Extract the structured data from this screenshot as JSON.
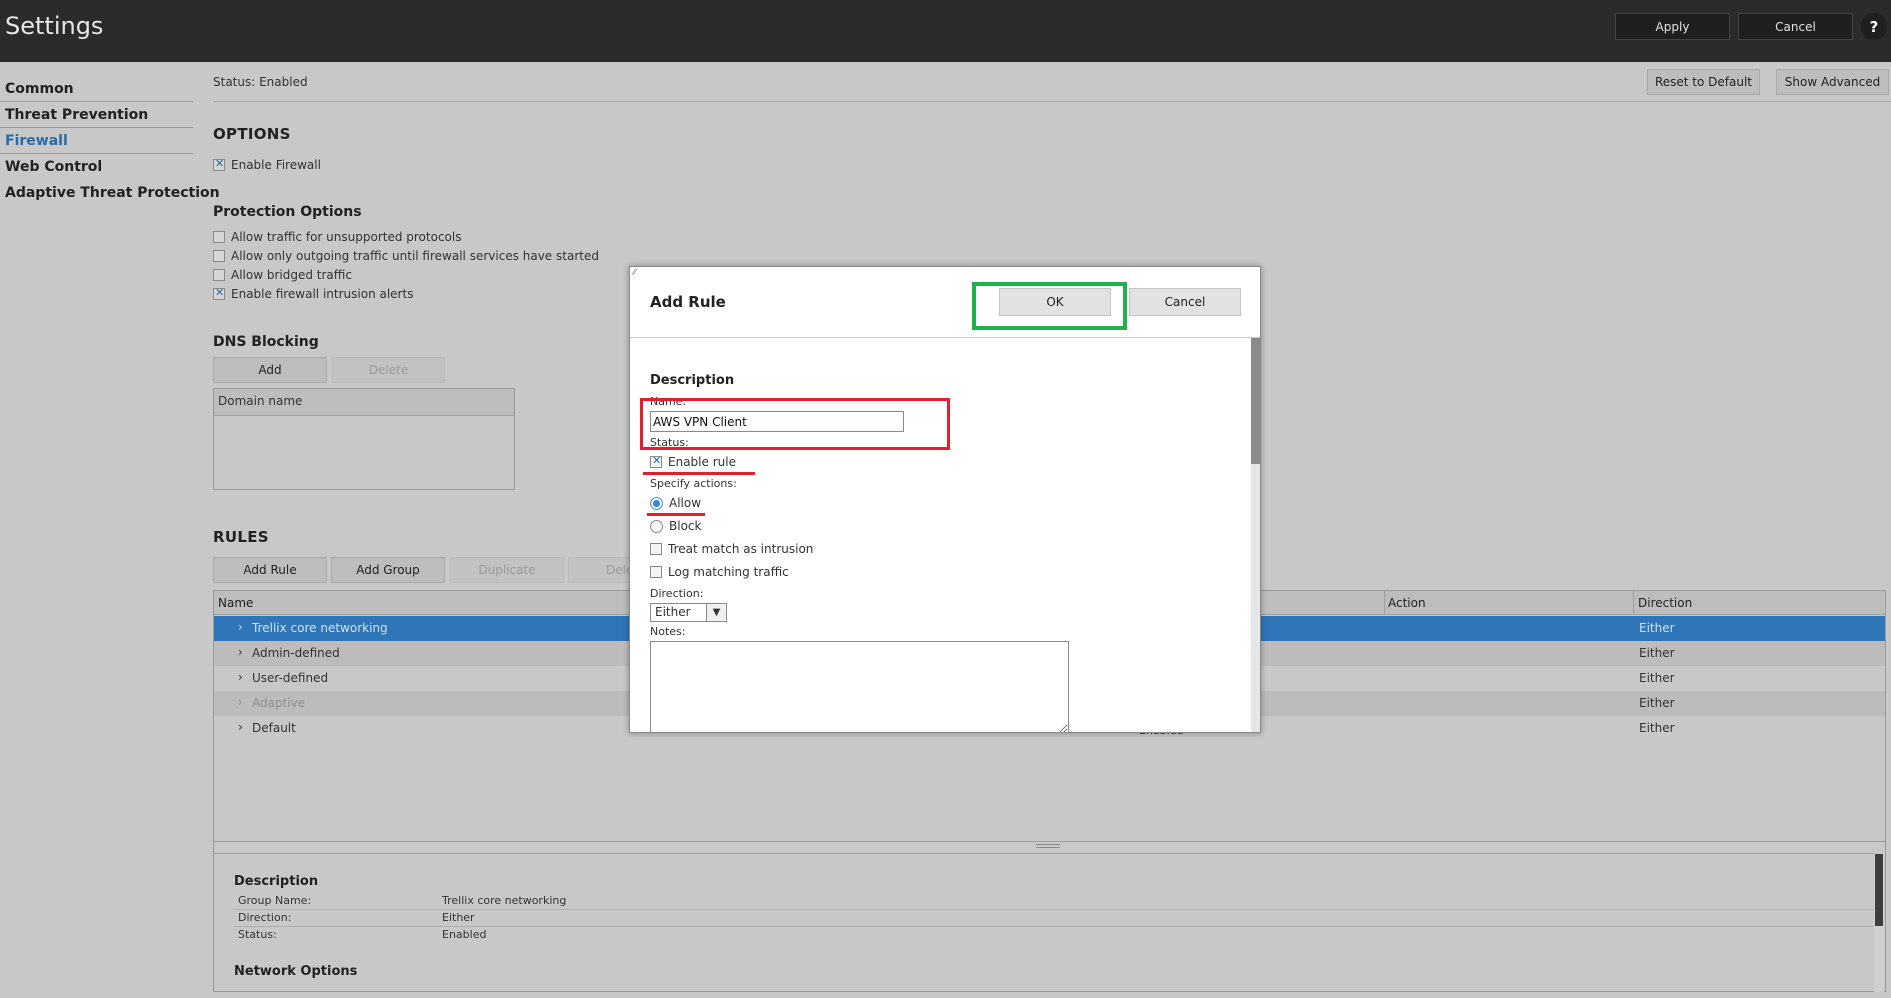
{
  "header": {
    "title": "Settings",
    "apply_label": "Apply",
    "cancel_label": "Cancel",
    "help_label": "?"
  },
  "nav": {
    "items": [
      {
        "label": "Common",
        "active": false
      },
      {
        "label": "Threat Prevention",
        "active": false
      },
      {
        "label": "Firewall",
        "active": true
      },
      {
        "label": "Web Control",
        "active": false
      },
      {
        "label": "Adaptive Threat Protection",
        "active": false
      }
    ]
  },
  "main": {
    "status_text": "Status: Enabled",
    "reset_label": "Reset to Default",
    "show_advanced_label": "Show Advanced",
    "options_title": "OPTIONS",
    "enable_firewall_label": "Enable Firewall",
    "protection_title": "Protection Options",
    "protection_options": [
      {
        "label": "Allow traffic for unsupported protocols",
        "checked": false
      },
      {
        "label": "Allow only outgoing traffic until firewall services have started",
        "checked": false
      },
      {
        "label": "Allow bridged traffic",
        "checked": false
      },
      {
        "label": "Enable firewall intrusion alerts",
        "checked": true
      }
    ],
    "dns_title": "DNS Blocking",
    "dns_add_label": "Add",
    "dns_delete_label": "Delete",
    "dns_column": "Domain name",
    "rules_title": "RULES",
    "rules_buttons": {
      "add_rule": "Add Rule",
      "add_group": "Add Group",
      "duplicate": "Duplicate",
      "delete": "Dele"
    },
    "rules_columns": {
      "name": "Name",
      "action": "Action",
      "direction": "Direction"
    },
    "rules_rows": [
      {
        "name": "Trellix core networking",
        "direction": "Either",
        "status": ""
      },
      {
        "name": "Admin-defined",
        "direction": "Either",
        "status": ""
      },
      {
        "name": "User-defined",
        "direction": "Either",
        "status": ""
      },
      {
        "name": "Adaptive",
        "direction": "Either",
        "status": ""
      },
      {
        "name": "Default",
        "direction": "Either",
        "status": "Enabled"
      }
    ],
    "description": {
      "title": "Description",
      "group_name_label": "Group Name:",
      "group_name_value": "Trellix core networking",
      "direction_label": "Direction:",
      "direction_value": "Either",
      "status_label": "Status:",
      "status_value": "Enabled",
      "network_options_title": "Network Options"
    }
  },
  "modal": {
    "title": "Add Rule",
    "ok_label": "OK",
    "cancel_label": "Cancel",
    "section_title": "Description",
    "name_label": "Name:",
    "name_value": "AWS VPN Client",
    "status_label": "Status:",
    "enable_rule_label": "Enable rule",
    "actions_label": "Specify actions:",
    "allow_label": "Allow",
    "block_label": "Block",
    "treat_intrusion_label": "Treat match as intrusion",
    "log_traffic_label": "Log matching traffic",
    "direction_label": "Direction:",
    "direction_value": "Either",
    "notes_label": "Notes:"
  },
  "colors": {
    "header_bg": "#2b2b2b",
    "accent": "#2a6aa6",
    "selected_row": "#2f76b8",
    "highlight_green": "#1bb34a",
    "highlight_red": "#e02030"
  }
}
